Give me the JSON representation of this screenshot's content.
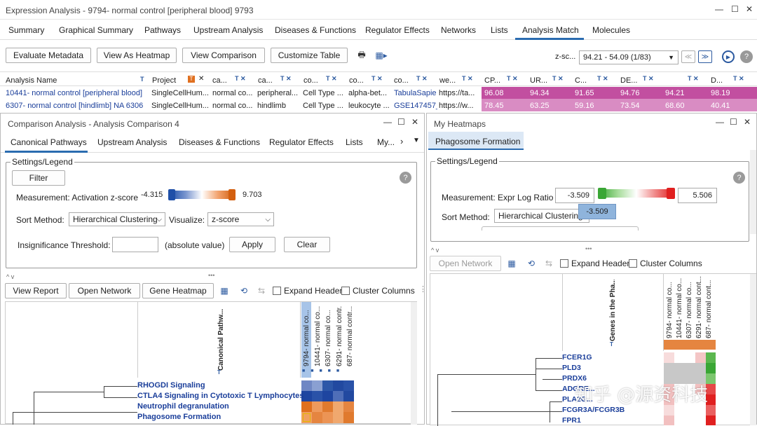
{
  "window": {
    "title": "Expression Analysis - 9794- normal control [peripheral blood]  9793"
  },
  "main_tabs": [
    "Summary",
    "Graphical Summary",
    "Pathways",
    "Upstream Analysis",
    "Diseases & Functions",
    "Regulator Effects",
    "Networks",
    "Lists",
    "Analysis Match",
    "Molecules"
  ],
  "toolbar": {
    "evaluate": "Evaluate Metadata",
    "heatmap": "View As Heatmap",
    "comparison": "View Comparison",
    "customize": "Customize Table",
    "zscore_label": "z-sc...",
    "zscore_range": "94.21 - 54.09 (1/83)"
  },
  "table": {
    "headers": [
      "Analysis Name",
      "Project",
      "ca...",
      "ca...",
      "co...",
      "co...",
      "co...",
      "we...",
      "CP...",
      "UR...",
      "C...",
      "DE...",
      "",
      "D..."
    ],
    "rows": [
      {
        "cells": [
          "10441- normal control [peripheral blood]",
          "SingleCellHum...",
          "normal co...",
          "peripheral...",
          "Cell Type ...",
          "alpha-bet...",
          "TabulaSapie",
          "https://ta...",
          "96.08",
          "94.34",
          "91.65",
          "94.76",
          "94.21",
          "98.19"
        ]
      },
      {
        "cells": [
          "6307- normal control [hindlimb] NA 6306",
          "SingleCellHum...",
          "normal co...",
          "hindlimb",
          "Cell Type ...",
          "leukocyte ...",
          "GSE147457_",
          "https://w...",
          "78.45",
          "63.25",
          "59.16",
          "73.54",
          "68.60",
          "40.41"
        ]
      }
    ]
  },
  "left_panel": {
    "title": "Comparison Analysis - Analysis Comparison 4",
    "tabs": [
      "Canonical Pathways",
      "Upstream Analysis",
      "Diseases & Functions",
      "Regulator Effects",
      "Lists",
      "My..."
    ],
    "legend_title": "Settings/Legend",
    "filter": "Filter",
    "measurement": "Measurement: Activation z-score",
    "min": "-4.315",
    "max": "9.703",
    "sort_label": "Sort Method:",
    "sort_value": "Hierarchical Clustering",
    "visualize_label": "Visualize:",
    "visualize_value": "z-score",
    "threshold_label": "Insignificance Threshold:",
    "threshold_unit": "(absolute value)",
    "apply": "Apply",
    "clear": "Clear",
    "view_report": "View Report",
    "open_network": "Open Network",
    "gene_heatmap": "Gene Heatmap",
    "expand_header": "Expand Header",
    "cluster_columns": "Cluster Columns",
    "row_header": "Canonical Pathw...",
    "columns": [
      "9794- normal co...",
      "10441- normal co...",
      "6307- normal co...",
      "6291- normal contr...",
      "687- normal contr..."
    ],
    "pathways": [
      "RHOGDI Signaling",
      "CTLA4 Signaling in Cytotoxic T Lymphocytes",
      "Neutrophil degranulation",
      "Phagosome Formation"
    ]
  },
  "right_panel": {
    "title": "My Heatmaps",
    "tab": "Phagosome Formation",
    "legend_title": "Settings/Legend",
    "measurement": "Measurement: Expr Log Ratio",
    "min": "-3.509",
    "max": "5.506",
    "sort_label": "Sort Method:",
    "sort_value": "Hierarchical Clustering",
    "tooltip": "-3.509",
    "open_network": "Open Network",
    "expand_header": "Expand Header",
    "cluster_columns": "Cluster Columns",
    "row_header": "Genes in the Pha...",
    "columns": [
      "9794- normal co...",
      "10441- normal co...",
      "6307- normal co...",
      "6291- normal cont...",
      "687- normal cont..."
    ],
    "genes": [
      "FCER1G",
      "PLD3",
      "PRDX6",
      "ADGRE...",
      "PLA2G...",
      "FCGR3A/FCGR3B",
      "FPR1"
    ]
  },
  "watermark": "知乎 @源资科技"
}
